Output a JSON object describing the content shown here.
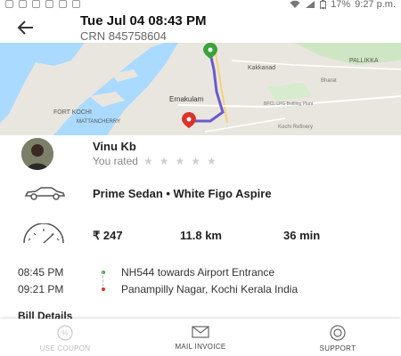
{
  "status_bar": {
    "battery_percent": "17%",
    "time": "9:27 p.m."
  },
  "header": {
    "title": "Tue Jul 04 08:43 PM",
    "crn": "CRN 845758604",
    "back_icon": "arrow-left-icon"
  },
  "map": {
    "labels": [
      "Kakkanad",
      "PALLIKKA",
      "Ernakulam",
      "FORT KOCHI",
      "MATTANCHERRY",
      "Kochi Refinery",
      "Bharat",
      "BPCL LPG Bottling Plant"
    ],
    "route_color": "#6a5acd",
    "start_pin_color": "#3aa23a",
    "end_pin_color": "#d9342b"
  },
  "driver": {
    "name": "Vinu Kb",
    "rated_label": "You rated",
    "rating": 0,
    "max_rating": 5
  },
  "vehicle": {
    "description": "Prime Sedan • White Figo Aspire",
    "icon": "car-icon"
  },
  "fare": {
    "amount": "₹ 247",
    "distance": "11.8 km",
    "duration": "36 min",
    "icon": "meter-icon"
  },
  "route": {
    "pickup_time": "08:45 PM",
    "pickup_place": "NH544 towards Airport Entrance",
    "drop_time": "09:21 PM",
    "drop_place": "Panampilly Nagar, Kochi Kerala India",
    "pickup_color": "#3aa23a",
    "drop_color": "#d9342b"
  },
  "bill": {
    "heading": "Bill Details"
  },
  "bottom_bar": {
    "coupon": {
      "label": "USE COUPON",
      "enabled": false,
      "icon": "coupon-icon"
    },
    "mail": {
      "label": "MAIL INVOICE",
      "enabled": true,
      "icon": "mail-icon"
    },
    "support": {
      "label": "SUPPORT",
      "enabled": true,
      "icon": "support-icon"
    }
  }
}
